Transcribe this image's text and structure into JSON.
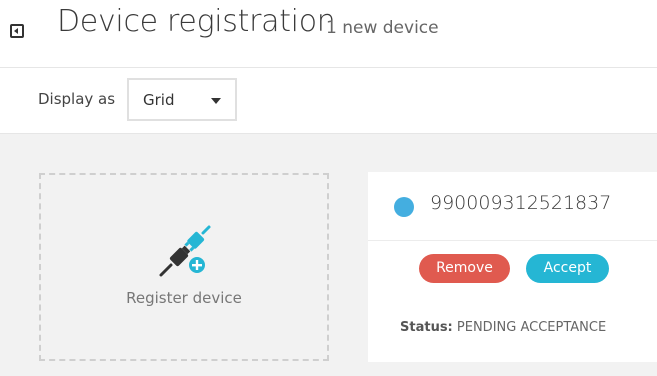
{
  "header": {
    "title": "Device registration",
    "subtitle": "1 new device",
    "back_icon": "collapse-left-icon"
  },
  "toolbar": {
    "display_label": "Display as",
    "display_select": {
      "value": "Grid",
      "caret_icon": "caret-down-icon"
    }
  },
  "register_tile": {
    "label": "Register device",
    "icon": "plug-add-icon",
    "colors": {
      "plug": "#333333",
      "accent": "#25b6d4"
    }
  },
  "device_card": {
    "device_id": "990009312521837",
    "dot_color": "#44aee0",
    "remove_label": "Remove",
    "accept_label": "Accept",
    "status_key": "Status:",
    "status_value": "PENDING ACCEPTANCE",
    "colors": {
      "remove": "#e05a4f",
      "accept": "#25b6d4"
    }
  }
}
